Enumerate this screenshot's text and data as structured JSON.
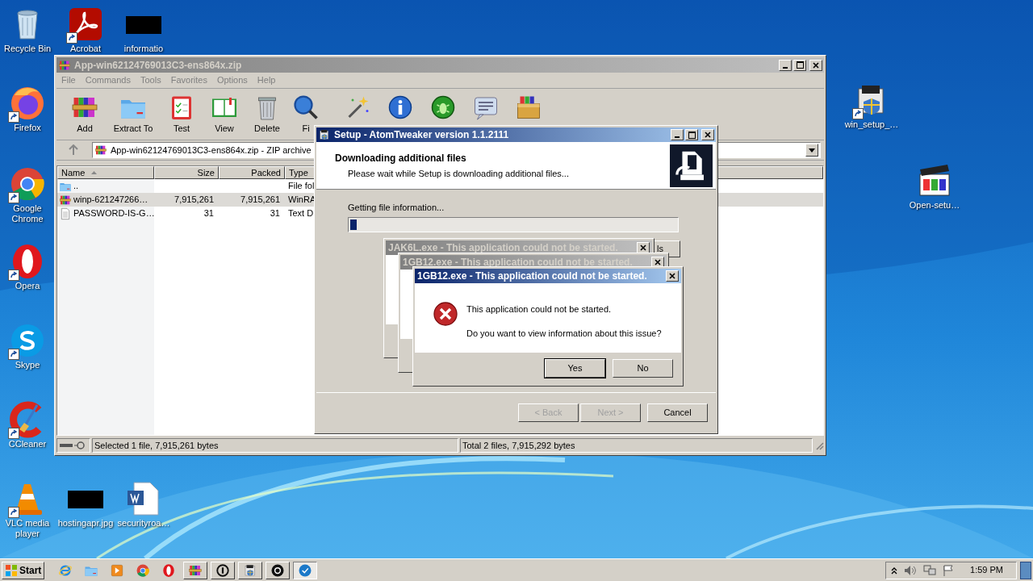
{
  "desktop_icons": [
    {
      "label": "Recycle Bin",
      "kind": "recycle-bin",
      "shortcut": false
    },
    {
      "label": "Acrobat",
      "kind": "pdf",
      "shortcut": true
    },
    {
      "label": "informatio",
      "kind": "thumbnail",
      "shortcut": false
    },
    {
      "label": "Firefox",
      "kind": "firefox",
      "shortcut": true
    },
    {
      "label": "Google Chrome",
      "kind": "chrome",
      "shortcut": true
    },
    {
      "label": "Opera",
      "kind": "opera",
      "shortcut": true
    },
    {
      "label": "Skype",
      "kind": "skype",
      "shortcut": true
    },
    {
      "label": "CCleaner",
      "kind": "ccleaner",
      "shortcut": true
    },
    {
      "label": "VLC media player",
      "kind": "vlc",
      "shortcut": true
    },
    {
      "label": "hostingapr.jpg",
      "kind": "thumbnail",
      "shortcut": false
    },
    {
      "label": "securityroa…",
      "kind": "word",
      "shortcut": false
    },
    {
      "label": "win_setup_…",
      "kind": "installer",
      "shortcut": true
    },
    {
      "label": "Open-setu…",
      "kind": "clapper",
      "shortcut": false
    }
  ],
  "archiver_window": {
    "title": "App-win62124769013C3-ens864x.zip",
    "active": false,
    "menu": [
      "File",
      "Commands",
      "Tools",
      "Favorites",
      "Options",
      "Help"
    ],
    "toolbar": [
      {
        "label": "Add",
        "kind": "add"
      },
      {
        "label": "Extract To",
        "kind": "extract"
      },
      {
        "label": "Test",
        "kind": "test"
      },
      {
        "label": "View",
        "kind": "view"
      },
      {
        "label": "Delete",
        "kind": "delete"
      },
      {
        "label": "Fi",
        "kind": "find"
      },
      {
        "kind": "wizard"
      },
      {
        "kind": "info"
      },
      {
        "kind": "virus"
      },
      {
        "kind": "comment"
      },
      {
        "kind": "sfx"
      }
    ],
    "address": "App-win62124769013C3-ens864x.zip - ZIP archive",
    "columns": [
      "Name",
      "Size",
      "Packed",
      "Type"
    ],
    "rows": [
      {
        "name": "..",
        "type": "File fol",
        "kind": "folder",
        "selected": false
      },
      {
        "name": "winp-621247266…",
        "size": "7,915,261",
        "packed": "7,915,261",
        "type": "WinRA",
        "kind": "archive",
        "selected": true
      },
      {
        "name": "PASSWORD-IS-G…",
        "size": "31",
        "packed": "31",
        "type": "Text D",
        "kind": "text",
        "selected": false
      }
    ],
    "status": [
      "Selected 1 file, 7,915,261 bytes",
      "Total 2 files, 7,915,292 bytes"
    ]
  },
  "setup_window": {
    "title": "Setup - AtomTweaker version 1.1.2111",
    "active": true,
    "heading": "Downloading additional files",
    "subheading": "Please wait while Setup is downloading additional files...",
    "status_text": "Getting file information...",
    "progress": {
      "level": 0.02
    },
    "partial_button": "ls",
    "buttons": [
      {
        "label": "< Back",
        "disabled": true
      },
      {
        "label": "Next >",
        "disabled": true
      },
      {
        "label": "Cancel",
        "disabled": false
      }
    ]
  },
  "error_dialogs": [
    {
      "title": "JAK6L.exe - This application could not be started.",
      "active": false
    },
    {
      "title": "1GB12.exe - This application could not be started.",
      "active": false
    },
    {
      "title": "1GB12.exe - This application could not be started.",
      "active": true,
      "message": [
        "This application could not be started.",
        "Do you want to view information about this issue?"
      ],
      "buttons": [
        {
          "label": "Yes",
          "default": true
        },
        {
          "label": "No",
          "default": false
        }
      ]
    }
  ],
  "taskbar": {
    "start": "Start",
    "items": [
      {
        "kind": "ie",
        "running": false,
        "active": false
      },
      {
        "kind": "folder",
        "running": false,
        "active": false
      },
      {
        "kind": "media",
        "running": false,
        "active": false
      },
      {
        "kind": "chrome",
        "running": false,
        "active": false
      },
      {
        "kind": "opera",
        "running": false,
        "active": false
      },
      {
        "kind": "archive",
        "running": true,
        "active": false
      },
      {
        "kind": "ring",
        "running": true,
        "active": false
      },
      {
        "kind": "installer",
        "running": true,
        "active": false
      },
      {
        "kind": "dark-circle",
        "running": true,
        "active": false
      },
      {
        "kind": "check-circle",
        "running": true,
        "active": true
      }
    ],
    "clock": "1:59 PM"
  }
}
